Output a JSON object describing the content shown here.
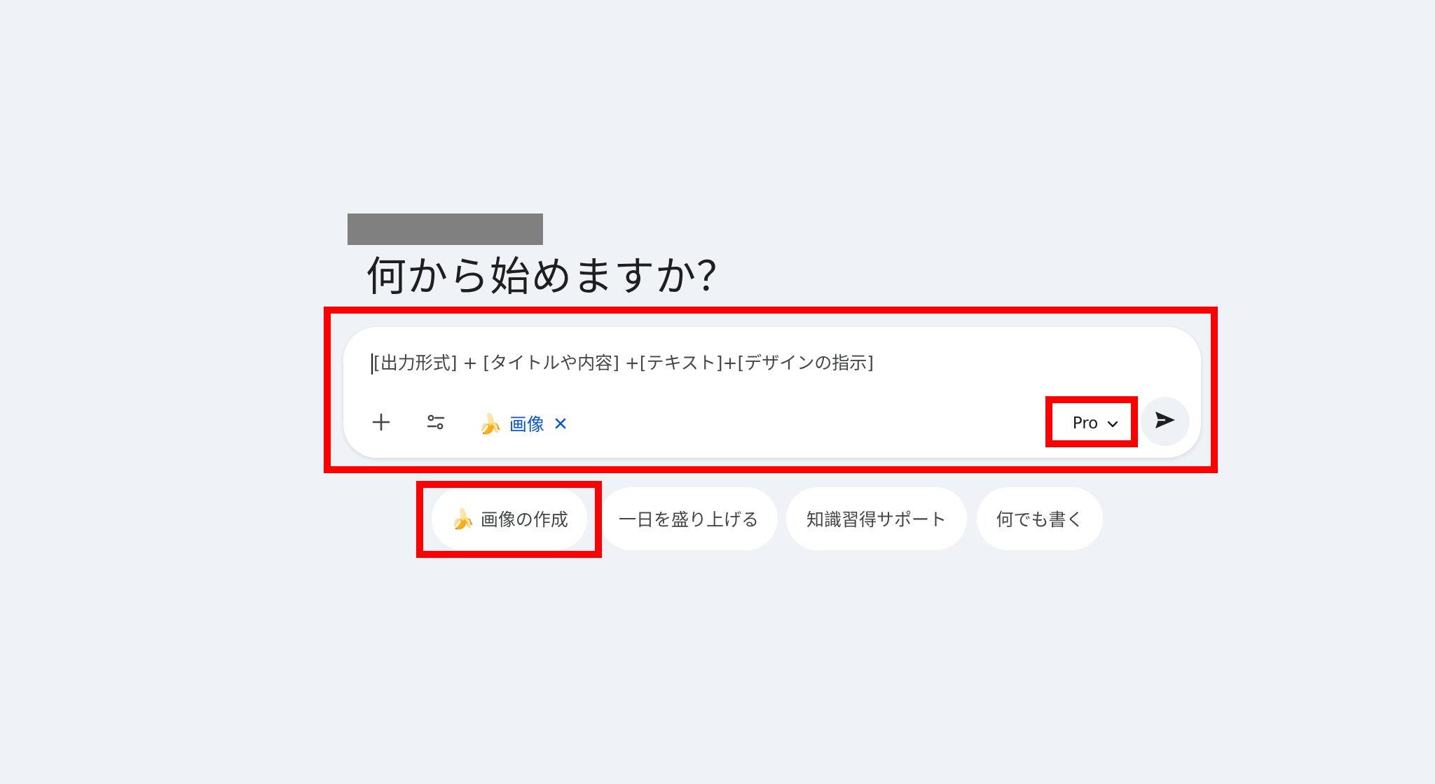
{
  "heading": "何から始めますか？",
  "composer": {
    "prompt_text": "[出力形式] + [タイトルや内容] +[テキスト]+[デザインの指示]",
    "add_icon": "plus-icon",
    "tools_icon": "tune-icon",
    "active_tool": {
      "emoji": "🍌",
      "label": "画像"
    },
    "model": {
      "label": "Pro",
      "icon": "chevron-down-icon"
    },
    "send_icon": "send-icon"
  },
  "suggestions": [
    {
      "emoji": "🍌",
      "label": "画像の作成"
    },
    {
      "label": "一日を盛り上げる"
    },
    {
      "label": "知識習得サポート"
    },
    {
      "label": "何でも書く"
    }
  ],
  "colors": {
    "background": "#eff2f7",
    "card": "#ffffff",
    "accent": "#0b57d0",
    "highlight": "#ff0000",
    "redaction": "#808080"
  }
}
